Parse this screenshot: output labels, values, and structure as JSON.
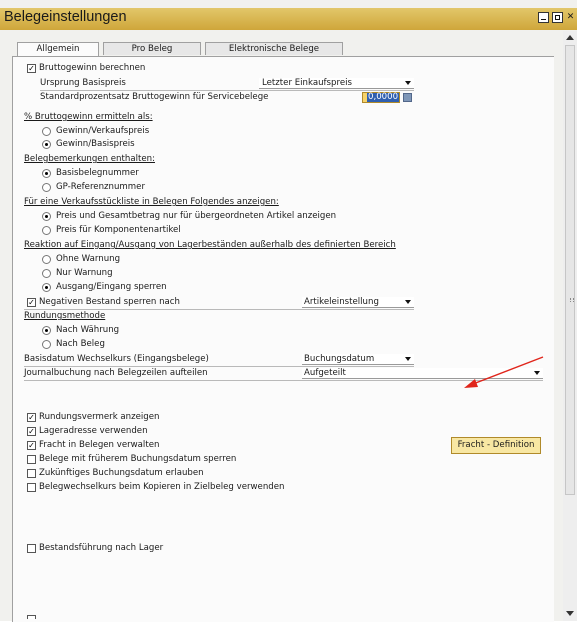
{
  "window": {
    "title": "Belegeinstellungen"
  },
  "tabs": [
    {
      "label": "Allgemein",
      "active": true
    },
    {
      "label": "Pro Beleg",
      "active": false
    },
    {
      "label": "Elektronische Belege",
      "active": false
    }
  ],
  "gross_profit": {
    "label": "Bruttogewinn berechnen",
    "checked": true,
    "basis_label": "Ursprung Basispreis",
    "basis_value": "Letzter Einkaufspreis",
    "percent_label": "Standardprozentsatz Bruttogewinn für Servicebelege",
    "percent_value": "0,0000"
  },
  "gross_profit_percent": {
    "header": "% Bruttogewinn ermitteln als:",
    "options": [
      "Gewinn/Verkaufspreis",
      "Gewinn/Basispreis"
    ],
    "selected": 1
  },
  "doc_remarks": {
    "header": "Belegbemerkungen enthalten:",
    "options": [
      "Basisbelegnummer",
      "GP-Referenznummer"
    ],
    "selected": 0
  },
  "bom": {
    "header": "Für eine Verkaufsstückliste in Belegen Folgendes anzeigen:",
    "options": [
      "Preis und Gesamtbetrag nur für übergeordneten Artikel anzeigen",
      "Preis für Komponentenartikel"
    ],
    "selected": 0
  },
  "reaction": {
    "header": "Reaktion auf Eingang/Ausgang von Lagerbeständen außerhalb des definierten Bereich",
    "options": [
      "Ohne Warnung",
      "Nur Warnung",
      "Ausgang/Eingang sperren"
    ],
    "selected": 2
  },
  "negative_stock": {
    "label": "Negativen Bestand sperren nach",
    "checked": true,
    "value": "Artikeleinstellung"
  },
  "rounding": {
    "header": "Rundungsmethode",
    "options": [
      "Nach Währung",
      "Nach Beleg"
    ],
    "selected": 0
  },
  "exchange_rate": {
    "label": "Basisdatum Wechselkurs (Eingangsbelege)",
    "value": "Buchungsdatum"
  },
  "journal": {
    "label": "Journalbuchung nach Belegzeilen aufteilen",
    "value": "Aufgeteilt"
  },
  "checkboxes": [
    {
      "label": "Rundungsvermerk anzeigen",
      "checked": true
    },
    {
      "label": "Lageradresse verwenden",
      "checked": true
    },
    {
      "label": "Fracht in Belegen verwalten",
      "checked": true
    },
    {
      "label": "Belege mit früherem Buchungsdatum sperren",
      "checked": false
    },
    {
      "label": "Zukünftiges Buchungsdatum erlauben",
      "checked": false
    },
    {
      "label": "Belegwechselkurs beim Kopieren in Zielbeleg verwenden",
      "checked": false
    }
  ],
  "inventory": {
    "label": "Bestandsführung nach Lager",
    "checked": false
  },
  "freight_button": {
    "label": "Fracht - Definition"
  },
  "colors": {
    "title_bar": "#d9b650",
    "button": "#f8e7a3",
    "arrow": "#e0251b"
  }
}
